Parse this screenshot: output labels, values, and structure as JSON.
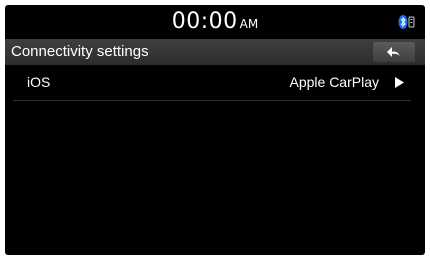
{
  "status_bar": {
    "time": "00:00",
    "ampm": "AM",
    "icons": [
      "bluetooth-icon",
      "phone-signal-icon"
    ]
  },
  "header": {
    "title": "Connectivity settings",
    "back_icon": "back-arrow-icon"
  },
  "settings": {
    "items": [
      {
        "label": "iOS",
        "value": "Apple CarPlay",
        "icon": "play-arrow-icon"
      }
    ]
  },
  "colors": {
    "background": "#000000",
    "title_bar": "#333333",
    "bluetooth": "#1a73e8",
    "text": "#ffffff"
  }
}
